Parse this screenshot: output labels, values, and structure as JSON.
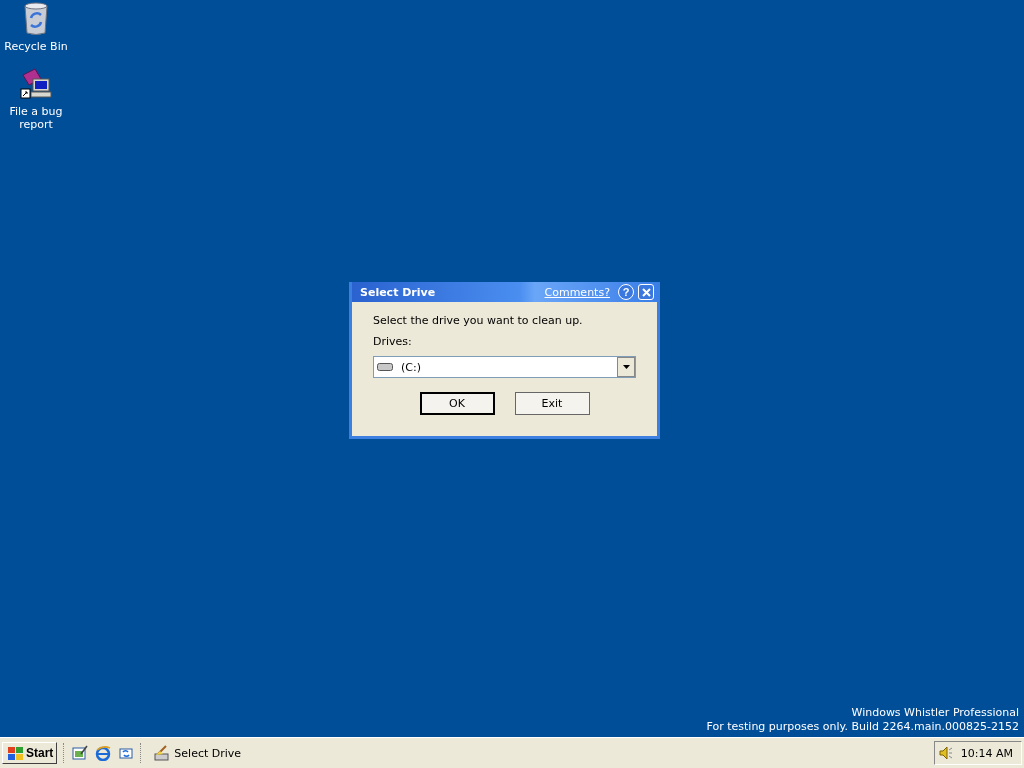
{
  "desktop_icons": [
    {
      "kind": "recycle",
      "label": "Recycle Bin"
    },
    {
      "kind": "bug",
      "label": "File a bug report"
    }
  ],
  "dialog": {
    "title": "Select Drive",
    "comments_link": "Comments?",
    "help_button": "?",
    "prompt": "Select the drive you want to clean up.",
    "drives_label": "Drives:",
    "drive_value": "(C:)",
    "buttons": [
      "OK",
      "Exit"
    ]
  },
  "watermark_text": [
    "Windows Whistler Professional",
    "For testing purposes only. Build 2264.main.000825-2152"
  ],
  "taskbar": {
    "start_label": "Start",
    "quick_launch": [
      {
        "kind": "desktop"
      },
      {
        "kind": "browser"
      },
      {
        "kind": "channels"
      }
    ],
    "tasks": [
      {
        "label": "Select Drive",
        "selected": false
      }
    ],
    "clock": "10:14 AM"
  }
}
